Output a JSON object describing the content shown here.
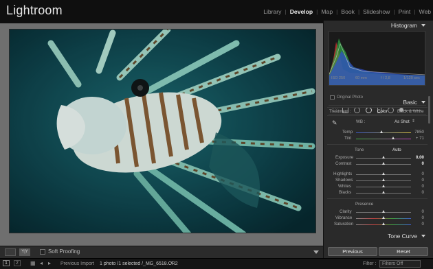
{
  "app": {
    "title": "Lightroom"
  },
  "modules": [
    {
      "label": "Library",
      "active": false
    },
    {
      "label": "Develop",
      "active": true
    },
    {
      "label": "Map",
      "active": false
    },
    {
      "label": "Book",
      "active": false
    },
    {
      "label": "Slideshow",
      "active": false
    },
    {
      "label": "Print",
      "active": false
    },
    {
      "label": "Web",
      "active": false
    }
  ],
  "toolbar": {
    "soft_proofing": "Soft Proofing",
    "view_label": "Y|Y"
  },
  "filmstrip": {
    "page1": "1",
    "page2": "2",
    "source": "Previous Import",
    "status": "1 photo /1 selected /_MG_6518.CR2",
    "filter_label": "Filter :",
    "filter_value": "Filters Off"
  },
  "histogram": {
    "title": "Histogram",
    "iso": "ISO 250",
    "focal": "60 mm",
    "aperture": "f / 2,8",
    "shutter": "1/120 sec",
    "original_photo": "Original Photo"
  },
  "basic": {
    "title": "Basic",
    "treatment_label": "Treatment :",
    "color": "Color",
    "bw": "Black & White",
    "wb_label": "WB :",
    "wb_value": "As Shot",
    "temp": {
      "label": "Temp",
      "value": "7850",
      "level": 0.47
    },
    "tint": {
      "label": "Tint",
      "value": "+ 71",
      "level": 0.68
    },
    "tone_label": "Tone",
    "auto": "Auto",
    "exposure": {
      "label": "Exposure",
      "value": "0,00",
      "level": 0.5
    },
    "contrast": {
      "label": "Contrast",
      "value": "0",
      "level": 0.5
    },
    "highlights": {
      "label": "Highlights",
      "value": "0",
      "level": 0.5
    },
    "shadows": {
      "label": "Shadows",
      "value": "0",
      "level": 0.5
    },
    "whites": {
      "label": "Whites",
      "value": "0",
      "level": 0.5
    },
    "blacks": {
      "label": "Blacks",
      "value": "0",
      "level": 0.5
    },
    "presence_label": "Presence",
    "clarity": {
      "label": "Clarity",
      "value": "0",
      "level": 0.5
    },
    "vibrance": {
      "label": "Vibrance",
      "value": "0",
      "level": 0.5
    },
    "saturation": {
      "label": "Saturation",
      "value": "0",
      "level": 0.5
    }
  },
  "tone_curve": {
    "title": "Tone Curve"
  },
  "buttons": {
    "previous": "Previous",
    "reset": "Reset"
  },
  "colors": {
    "accent": "#efefef",
    "background": "#1c1c1c",
    "panel": "#2a2a2a"
  }
}
